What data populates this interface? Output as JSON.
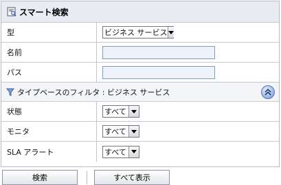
{
  "header": {
    "title": "スマート検索",
    "icon": "search-panel-icon"
  },
  "fields": {
    "type": {
      "label": "型",
      "value": "ビジネス サービス"
    },
    "name": {
      "label": "名前",
      "value": ""
    },
    "path": {
      "label": "パス",
      "value": ""
    }
  },
  "filter": {
    "text": "タイプベースのフィルタ : ビジネス サービス",
    "icon": "filter-icon",
    "collapse_icon": "collapse-up-icon"
  },
  "filters": {
    "status": {
      "label": "状態",
      "value": "すべて"
    },
    "monitor": {
      "label": "モニタ",
      "value": "すべて"
    },
    "sla": {
      "label": "SLA アラート",
      "value": "すべて"
    }
  },
  "buttons": {
    "search": "検索",
    "show_all": "すべて表示"
  },
  "colors": {
    "header_bg": "#e9edf3",
    "border": "#c3c8d0",
    "input_bg": "#eef3fb"
  }
}
